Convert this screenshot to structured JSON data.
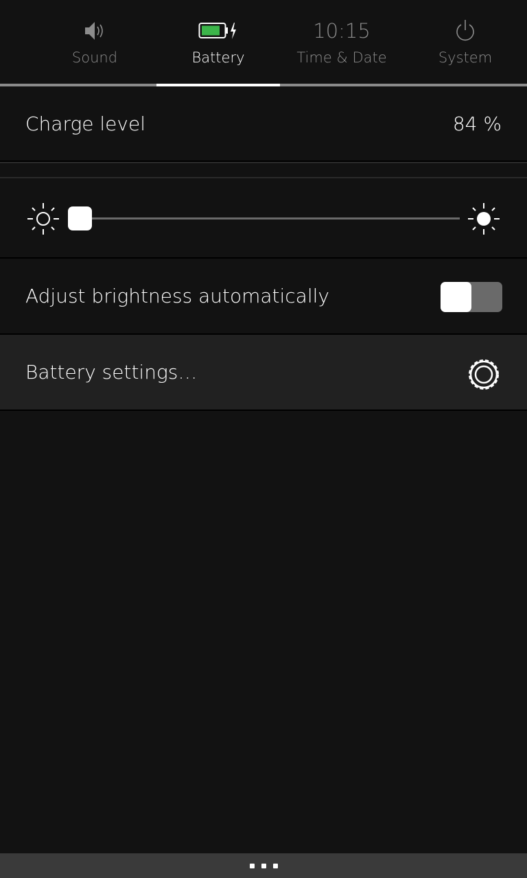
{
  "tabs": [
    {
      "label": "",
      "icon": "network-icon",
      "active": false
    },
    {
      "label": "Sound",
      "icon": "speaker-icon",
      "active": false
    },
    {
      "label": "Battery",
      "icon": "battery-charging-icon",
      "active": true
    },
    {
      "label": "Time & Date",
      "time": "10:15",
      "active": false
    },
    {
      "label": "System",
      "icon": "power-icon",
      "active": false
    }
  ],
  "battery": {
    "charge_label": "Charge level",
    "charge_value": "84 %",
    "charge_fraction": 0.84,
    "brightness_fraction": 0.0,
    "auto_brightness_label": "Adjust brightness automatically",
    "auto_brightness_on": false,
    "settings_label": "Battery settings…"
  },
  "colors": {
    "battery_fill": "#3cb54a",
    "background": "#121212",
    "highlight_row": "#212121"
  }
}
